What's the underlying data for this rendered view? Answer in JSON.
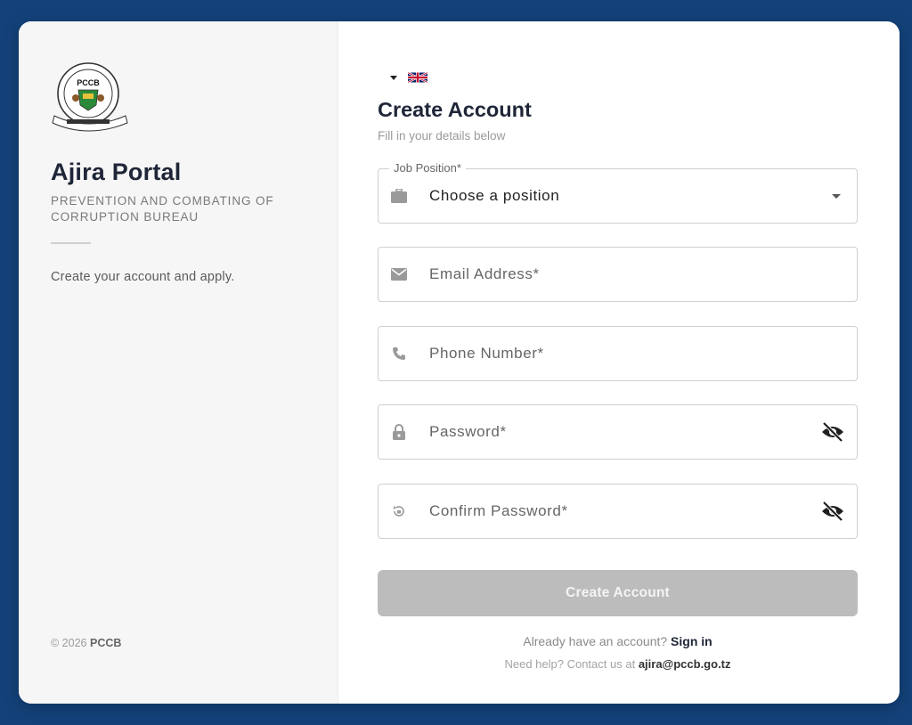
{
  "brand": {
    "logo_text": "PCCB",
    "title": "Ajira Portal",
    "org_name": "PREVENTION AND COMBATING OF CORRUPTION BUREAU",
    "tagline": "Create your account and apply.",
    "copyright_prefix": "© 2026",
    "copyright_org": "PCCB"
  },
  "language": {
    "icon": "uk-flag-icon",
    "selected": "English"
  },
  "form": {
    "title": "Create Account",
    "subtitle": "Fill in your details below",
    "job_position": {
      "label": "Job Position*",
      "value": "Choose a position",
      "icon": "briefcase-icon"
    },
    "email": {
      "placeholder": "Email Address*",
      "icon": "email-icon"
    },
    "phone": {
      "placeholder": "Phone Number*",
      "icon": "phone-icon"
    },
    "password": {
      "placeholder": "Password*",
      "icon": "lock-icon",
      "toggle_icon": "eye-off-icon"
    },
    "confirm_password": {
      "placeholder": "Confirm Password*",
      "icon": "lock-reset-icon",
      "toggle_icon": "eye-off-icon"
    },
    "submit_label": "Create Account",
    "signin_prompt": "Already have an account?",
    "signin_link": "Sign in",
    "help_prompt": "Need help? Contact us at",
    "help_email": "ajira@pccb.go.tz"
  },
  "colors": {
    "background": "#13427a",
    "heading": "#1f2638",
    "button_disabled": "#bdbcbd"
  }
}
